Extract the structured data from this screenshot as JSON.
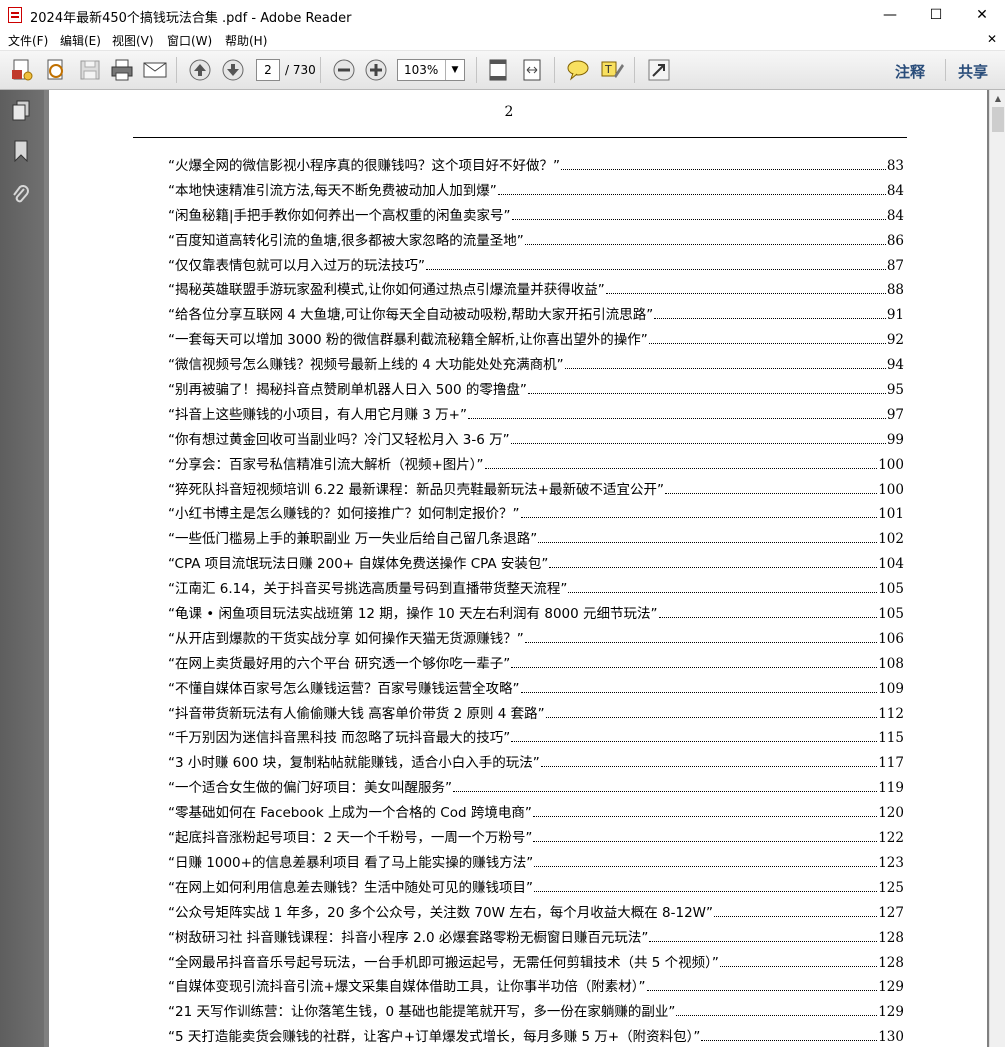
{
  "window": {
    "title": "2024年最新450个搞钱玩法合集 .pdf - Adobe Reader",
    "minimize": "—",
    "maximize": "☐",
    "close": "✕"
  },
  "menu": {
    "items": [
      "文件(F)",
      "编辑(E)",
      "视图(V)",
      "窗口(W)",
      "帮助(H)"
    ],
    "close_doc": "✕"
  },
  "toolbar": {
    "current_page": "2",
    "total_pages": "/ 730",
    "zoom": "103%",
    "annotate_label": "注释",
    "share_label": "共享"
  },
  "document": {
    "page_number": "2",
    "toc": [
      {
        "title": "“火爆全网的微信影视小程序真的很赚钱吗？这个项目好不好做？”",
        "page": "83"
      },
      {
        "title": "“本地快速精准引流方法,每天不断免费被动加人加到爆”",
        "page": "84"
      },
      {
        "title": "“闲鱼秘籍|手把手教你如何养出一个高权重的闲鱼卖家号”",
        "page": "84"
      },
      {
        "title": "“百度知道高转化引流的鱼塘,很多都被大家忽略的流量圣地”",
        "page": "86"
      },
      {
        "title": "“仅仅靠表情包就可以月入过万的玩法技巧”",
        "page": "87"
      },
      {
        "title": "“揭秘英雄联盟手游玩家盈利模式,让你如何通过热点引爆流量并获得收益”",
        "page": "88"
      },
      {
        "title": "“给各位分享互联网 4 大鱼塘,可让你每天全自动被动吸粉,帮助大家开拓引流思路”",
        "page": "91"
      },
      {
        "title": "“一套每天可以增加 3000 粉的微信群暴利截流秘籍全解析,让你喜出望外的操作”",
        "page": "92"
      },
      {
        "title": "“微信视频号怎么赚钱？视频号最新上线的 4 大功能处处充满商机”",
        "page": "94"
      },
      {
        "title": "“别再被骗了！揭秘抖音点赞刷单机器人日入 500 的零撸盘”",
        "page": "95"
      },
      {
        "title": "“抖音上这些赚钱的小项目，有人用它月赚 3 万+”",
        "page": "97"
      },
      {
        "title": "“你有想过黄金回收可当副业吗？冷门又轻松月入 3-6 万”",
        "page": "99"
      },
      {
        "title": "“分享会：百家号私信精准引流大解析（视频+图片）”",
        "page": "100"
      },
      {
        "title": "“猝死队抖音短视频培训 6.22 最新课程：新品贝壳鞋最新玩法+最新破不适宜公开”",
        "page": "100"
      },
      {
        "title": "“小红书博主是怎么赚钱的？如何接推广？如何制定报价？”",
        "page": "101"
      },
      {
        "title": "“一些低门槛易上手的兼职副业 万一失业后给自己留几条退路”",
        "page": "102"
      },
      {
        "title": "“CPA 项目流氓玩法日赚 200+ 自媒体免费送操作 CPA 安装包”",
        "page": "104"
      },
      {
        "title": "“江南汇 6.14，关于抖音买号挑选高质量号码到直播带货整天流程”",
        "page": "105"
      },
      {
        "title": "“龟课 • 闲鱼项目玩法实战班第 12 期，操作 10 天左右利润有 8000 元细节玩法”",
        "page": "105"
      },
      {
        "title": "“从开店到爆款的干货实战分享 如何操作天猫无货源赚钱？”",
        "page": "106"
      },
      {
        "title": "“在网上卖货最好用的六个平台 研究透一个够你吃一辈子”",
        "page": "108"
      },
      {
        "title": "“不懂自媒体百家号怎么赚钱运营？百家号赚钱运营全攻略”",
        "page": "109"
      },
      {
        "title": "“抖音带货新玩法有人偷偷赚大钱 高客单价带货 2 原则 4 套路”",
        "page": "112"
      },
      {
        "title": "“千万别因为迷信抖音黑科技 而忽略了玩抖音最大的技巧”",
        "page": "115"
      },
      {
        "title": "“3 小时赚 600 块，复制粘帖就能赚钱，适合小白入手的玩法”",
        "page": "117"
      },
      {
        "title": "“一个适合女生做的偏门好项目：美女叫醒服务”",
        "page": "119"
      },
      {
        "title": "“零基础如何在 Facebook 上成为一个合格的 Cod 跨境电商”",
        "page": "120"
      },
      {
        "title": "“起底抖音涨粉起号项目：2 天一个千粉号，一周一个万粉号”",
        "page": "122"
      },
      {
        "title": "“日赚 1000+的信息差暴利项目 看了马上能实操的赚钱方法”",
        "page": "123"
      },
      {
        "title": "“在网上如何利用信息差去赚钱？生活中随处可见的赚钱项目”",
        "page": "125"
      },
      {
        "title": "“公众号矩阵实战 1 年多，20 多个公众号，关注数 70W 左右，每个月收益大概在 8-12W”",
        "page": "127"
      },
      {
        "title": "“树敌研习社 抖音赚钱课程：抖音小程序 2.0 必爆套路零粉无橱窗日赚百元玩法”",
        "page": "128"
      },
      {
        "title": "“全网最吊抖音音乐号起号玩法，一台手机即可搬运起号，无需任何剪辑技术（共 5 个视频）”",
        "page": "128"
      },
      {
        "title": "“自媒体变现引流抖音引流+爆文采集自媒体借助工具，让你事半功倍（附素材）”",
        "page": "129"
      },
      {
        "title": "“21 天写作训练营：让你落笔生钱，0 基础也能提笔就开写，多一份在家躺赚的副业”",
        "page": "129"
      },
      {
        "title": "“5 天打造能卖货会赚钱的社群，让客户+订单爆发式增长，每月多赚 5 万+（附资料包）”",
        "page": "130"
      }
    ]
  },
  "colors": {
    "toolbar_link": "#2a4d7a",
    "doc_background": "#808080",
    "left_pane": "#666666"
  }
}
